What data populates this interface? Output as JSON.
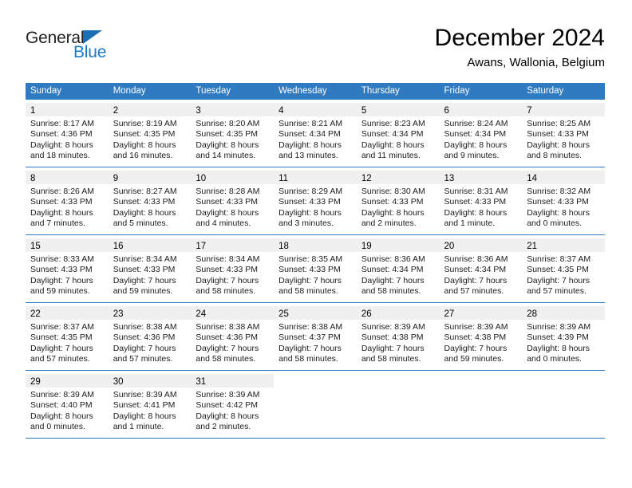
{
  "logo": {
    "word_top": "General",
    "word_bottom": "Blue",
    "triangle_color": "#1a6fb5",
    "blue_color": "#1a7ac4"
  },
  "header": {
    "title": "December 2024",
    "subtitle": "Awans, Wallonia, Belgium"
  },
  "theme": {
    "header_blue": "#2f7ac1",
    "daynum_band": "#f0f0f0",
    "row_rule": "#2f7ac1"
  },
  "weekdays": [
    "Sunday",
    "Monday",
    "Tuesday",
    "Wednesday",
    "Thursday",
    "Friday",
    "Saturday"
  ],
  "weeks": [
    [
      {
        "day": "1",
        "sunrise": "Sunrise: 8:17 AM",
        "sunset": "Sunset: 4:36 PM",
        "daylight1": "Daylight: 8 hours",
        "daylight2": "and 18 minutes."
      },
      {
        "day": "2",
        "sunrise": "Sunrise: 8:19 AM",
        "sunset": "Sunset: 4:35 PM",
        "daylight1": "Daylight: 8 hours",
        "daylight2": "and 16 minutes."
      },
      {
        "day": "3",
        "sunrise": "Sunrise: 8:20 AM",
        "sunset": "Sunset: 4:35 PM",
        "daylight1": "Daylight: 8 hours",
        "daylight2": "and 14 minutes."
      },
      {
        "day": "4",
        "sunrise": "Sunrise: 8:21 AM",
        "sunset": "Sunset: 4:34 PM",
        "daylight1": "Daylight: 8 hours",
        "daylight2": "and 13 minutes."
      },
      {
        "day": "5",
        "sunrise": "Sunrise: 8:23 AM",
        "sunset": "Sunset: 4:34 PM",
        "daylight1": "Daylight: 8 hours",
        "daylight2": "and 11 minutes."
      },
      {
        "day": "6",
        "sunrise": "Sunrise: 8:24 AM",
        "sunset": "Sunset: 4:34 PM",
        "daylight1": "Daylight: 8 hours",
        "daylight2": "and 9 minutes."
      },
      {
        "day": "7",
        "sunrise": "Sunrise: 8:25 AM",
        "sunset": "Sunset: 4:33 PM",
        "daylight1": "Daylight: 8 hours",
        "daylight2": "and 8 minutes."
      }
    ],
    [
      {
        "day": "8",
        "sunrise": "Sunrise: 8:26 AM",
        "sunset": "Sunset: 4:33 PM",
        "daylight1": "Daylight: 8 hours",
        "daylight2": "and 7 minutes."
      },
      {
        "day": "9",
        "sunrise": "Sunrise: 8:27 AM",
        "sunset": "Sunset: 4:33 PM",
        "daylight1": "Daylight: 8 hours",
        "daylight2": "and 5 minutes."
      },
      {
        "day": "10",
        "sunrise": "Sunrise: 8:28 AM",
        "sunset": "Sunset: 4:33 PM",
        "daylight1": "Daylight: 8 hours",
        "daylight2": "and 4 minutes."
      },
      {
        "day": "11",
        "sunrise": "Sunrise: 8:29 AM",
        "sunset": "Sunset: 4:33 PM",
        "daylight1": "Daylight: 8 hours",
        "daylight2": "and 3 minutes."
      },
      {
        "day": "12",
        "sunrise": "Sunrise: 8:30 AM",
        "sunset": "Sunset: 4:33 PM",
        "daylight1": "Daylight: 8 hours",
        "daylight2": "and 2 minutes."
      },
      {
        "day": "13",
        "sunrise": "Sunrise: 8:31 AM",
        "sunset": "Sunset: 4:33 PM",
        "daylight1": "Daylight: 8 hours",
        "daylight2": "and 1 minute."
      },
      {
        "day": "14",
        "sunrise": "Sunrise: 8:32 AM",
        "sunset": "Sunset: 4:33 PM",
        "daylight1": "Daylight: 8 hours",
        "daylight2": "and 0 minutes."
      }
    ],
    [
      {
        "day": "15",
        "sunrise": "Sunrise: 8:33 AM",
        "sunset": "Sunset: 4:33 PM",
        "daylight1": "Daylight: 7 hours",
        "daylight2": "and 59 minutes."
      },
      {
        "day": "16",
        "sunrise": "Sunrise: 8:34 AM",
        "sunset": "Sunset: 4:33 PM",
        "daylight1": "Daylight: 7 hours",
        "daylight2": "and 59 minutes."
      },
      {
        "day": "17",
        "sunrise": "Sunrise: 8:34 AM",
        "sunset": "Sunset: 4:33 PM",
        "daylight1": "Daylight: 7 hours",
        "daylight2": "and 58 minutes."
      },
      {
        "day": "18",
        "sunrise": "Sunrise: 8:35 AM",
        "sunset": "Sunset: 4:33 PM",
        "daylight1": "Daylight: 7 hours",
        "daylight2": "and 58 minutes."
      },
      {
        "day": "19",
        "sunrise": "Sunrise: 8:36 AM",
        "sunset": "Sunset: 4:34 PM",
        "daylight1": "Daylight: 7 hours",
        "daylight2": "and 58 minutes."
      },
      {
        "day": "20",
        "sunrise": "Sunrise: 8:36 AM",
        "sunset": "Sunset: 4:34 PM",
        "daylight1": "Daylight: 7 hours",
        "daylight2": "and 57 minutes."
      },
      {
        "day": "21",
        "sunrise": "Sunrise: 8:37 AM",
        "sunset": "Sunset: 4:35 PM",
        "daylight1": "Daylight: 7 hours",
        "daylight2": "and 57 minutes."
      }
    ],
    [
      {
        "day": "22",
        "sunrise": "Sunrise: 8:37 AM",
        "sunset": "Sunset: 4:35 PM",
        "daylight1": "Daylight: 7 hours",
        "daylight2": "and 57 minutes."
      },
      {
        "day": "23",
        "sunrise": "Sunrise: 8:38 AM",
        "sunset": "Sunset: 4:36 PM",
        "daylight1": "Daylight: 7 hours",
        "daylight2": "and 57 minutes."
      },
      {
        "day": "24",
        "sunrise": "Sunrise: 8:38 AM",
        "sunset": "Sunset: 4:36 PM",
        "daylight1": "Daylight: 7 hours",
        "daylight2": "and 58 minutes."
      },
      {
        "day": "25",
        "sunrise": "Sunrise: 8:38 AM",
        "sunset": "Sunset: 4:37 PM",
        "daylight1": "Daylight: 7 hours",
        "daylight2": "and 58 minutes."
      },
      {
        "day": "26",
        "sunrise": "Sunrise: 8:39 AM",
        "sunset": "Sunset: 4:38 PM",
        "daylight1": "Daylight: 7 hours",
        "daylight2": "and 58 minutes."
      },
      {
        "day": "27",
        "sunrise": "Sunrise: 8:39 AM",
        "sunset": "Sunset: 4:38 PM",
        "daylight1": "Daylight: 7 hours",
        "daylight2": "and 59 minutes."
      },
      {
        "day": "28",
        "sunrise": "Sunrise: 8:39 AM",
        "sunset": "Sunset: 4:39 PM",
        "daylight1": "Daylight: 8 hours",
        "daylight2": "and 0 minutes."
      }
    ],
    [
      {
        "day": "29",
        "sunrise": "Sunrise: 8:39 AM",
        "sunset": "Sunset: 4:40 PM",
        "daylight1": "Daylight: 8 hours",
        "daylight2": "and 0 minutes."
      },
      {
        "day": "30",
        "sunrise": "Sunrise: 8:39 AM",
        "sunset": "Sunset: 4:41 PM",
        "daylight1": "Daylight: 8 hours",
        "daylight2": "and 1 minute."
      },
      {
        "day": "31",
        "sunrise": "Sunrise: 8:39 AM",
        "sunset": "Sunset: 4:42 PM",
        "daylight1": "Daylight: 8 hours",
        "daylight2": "and 2 minutes."
      },
      {
        "day": "",
        "sunrise": "",
        "sunset": "",
        "daylight1": "",
        "daylight2": ""
      },
      {
        "day": "",
        "sunrise": "",
        "sunset": "",
        "daylight1": "",
        "daylight2": ""
      },
      {
        "day": "",
        "sunrise": "",
        "sunset": "",
        "daylight1": "",
        "daylight2": ""
      },
      {
        "day": "",
        "sunrise": "",
        "sunset": "",
        "daylight1": "",
        "daylight2": ""
      }
    ]
  ]
}
